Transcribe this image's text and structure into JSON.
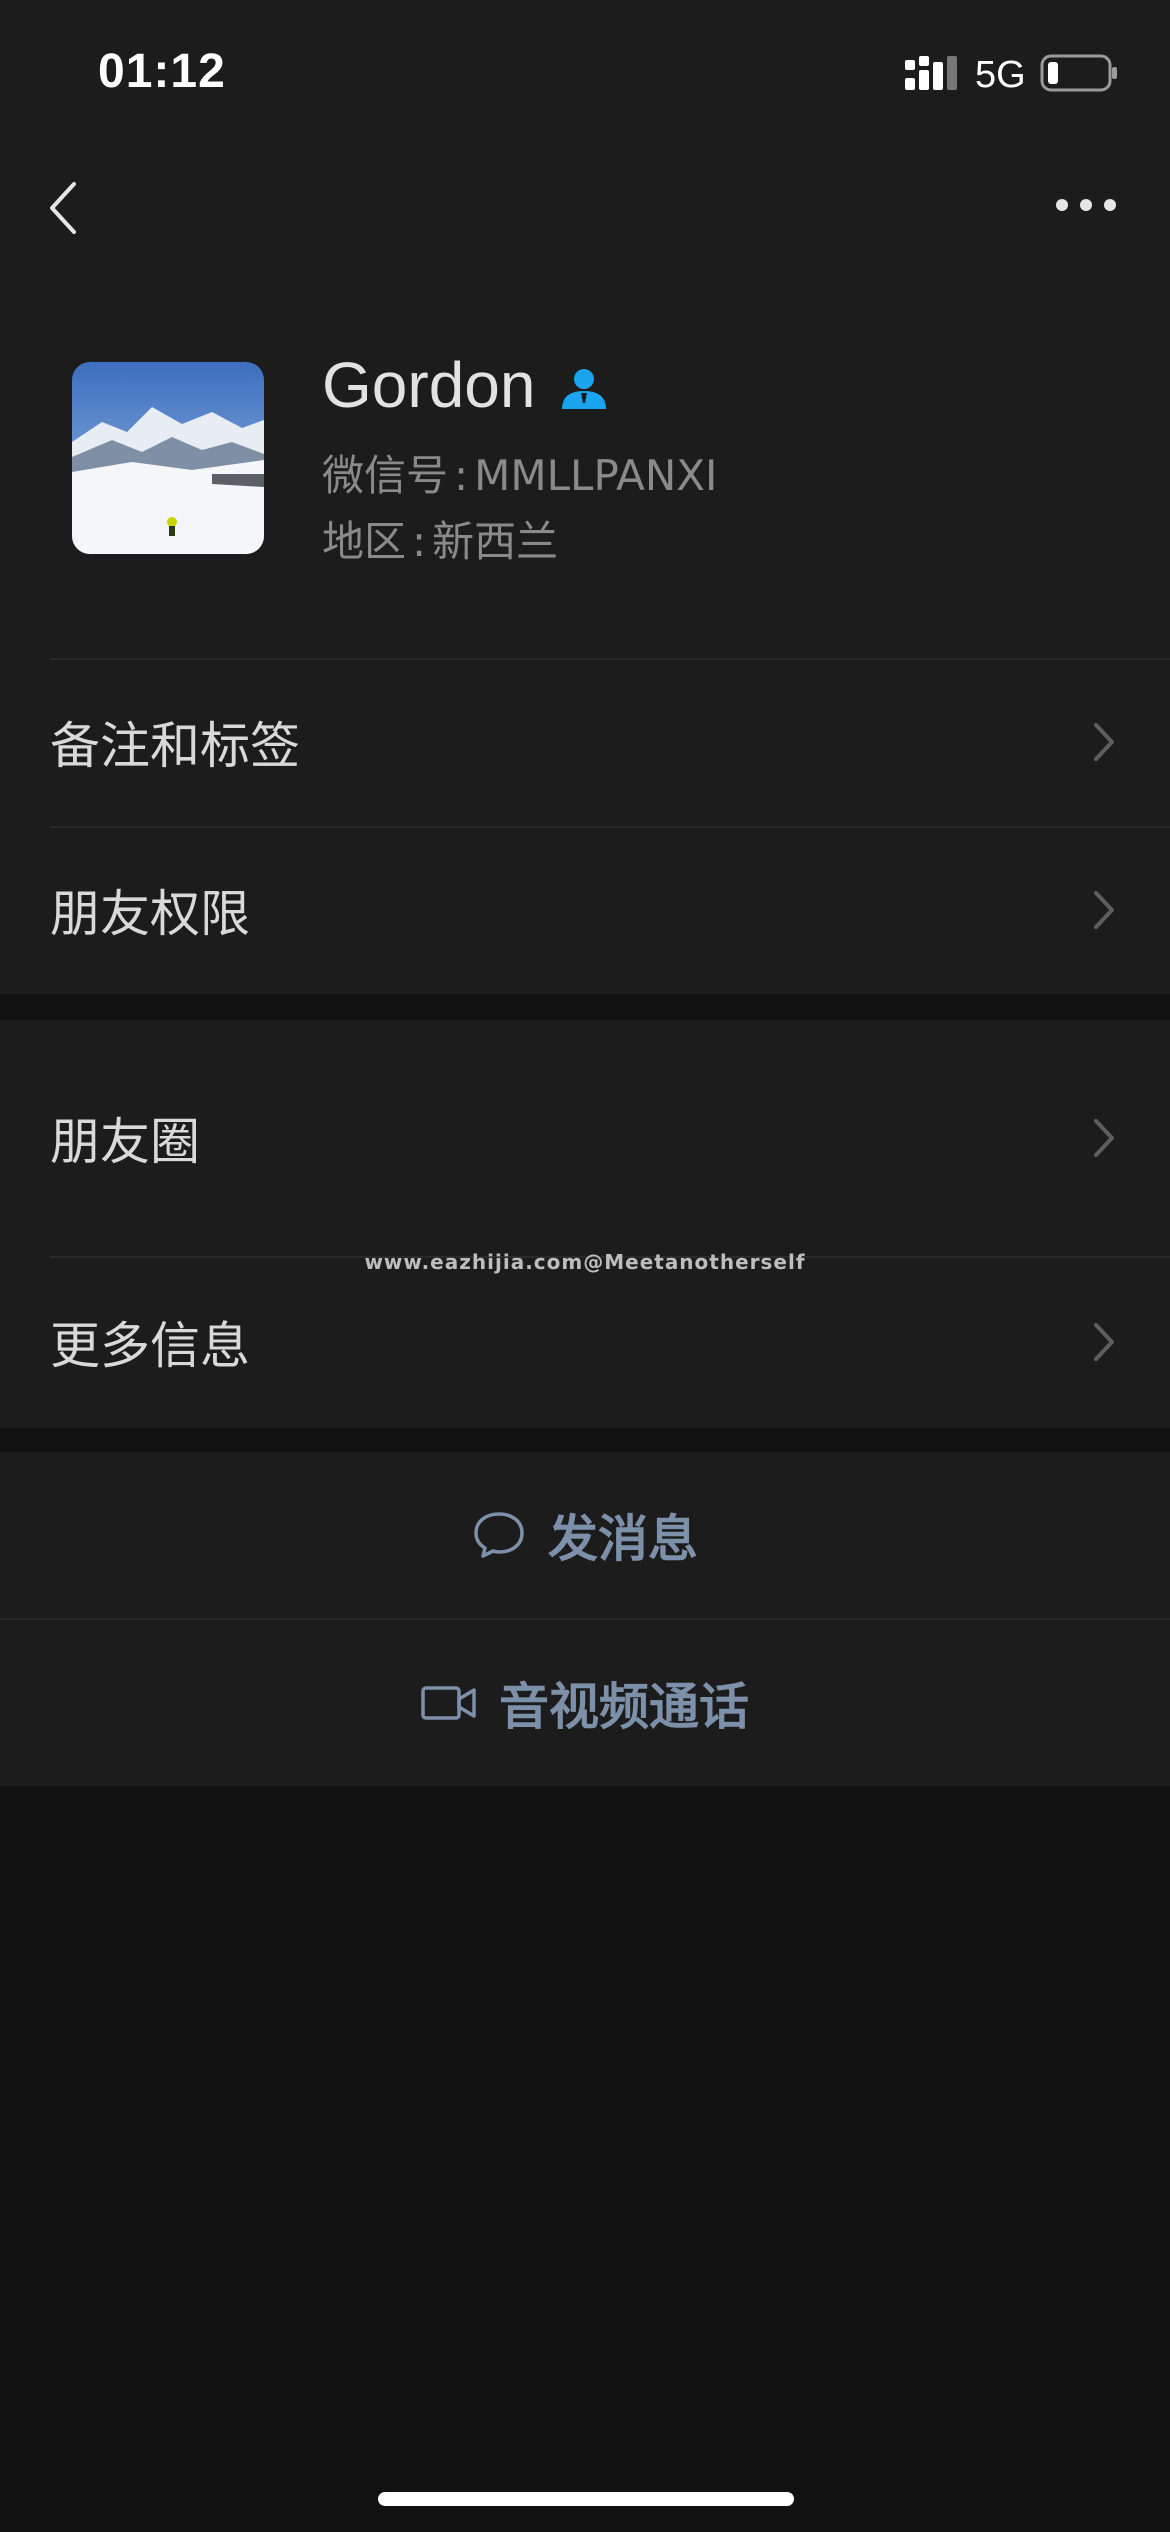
{
  "status_bar": {
    "time": "01:12",
    "network": "5G",
    "battery_level": 0.15
  },
  "nav": {
    "back_icon": "chevron-left-icon",
    "more_icon": "ellipsis-icon"
  },
  "profile": {
    "name": "Gordon",
    "wechat_id_label": "微信号",
    "wechat_id_value": "MMLLPANXI",
    "region_label": "地区",
    "region_value": "新西兰",
    "separator": ":"
  },
  "list": {
    "group1": [
      "备注和标签",
      "朋友权限"
    ],
    "group2": [
      "朋友圈",
      "更多信息"
    ]
  },
  "watermark": "www.eazhijia.com@Meetanotherself",
  "actions": {
    "message_label": "发消息",
    "call_label": "音视频通话"
  },
  "colors": {
    "background": "#111111",
    "surface": "#1c1c1c",
    "action_text": "#7d90a9",
    "contact_badge": "#1aa4ee"
  }
}
